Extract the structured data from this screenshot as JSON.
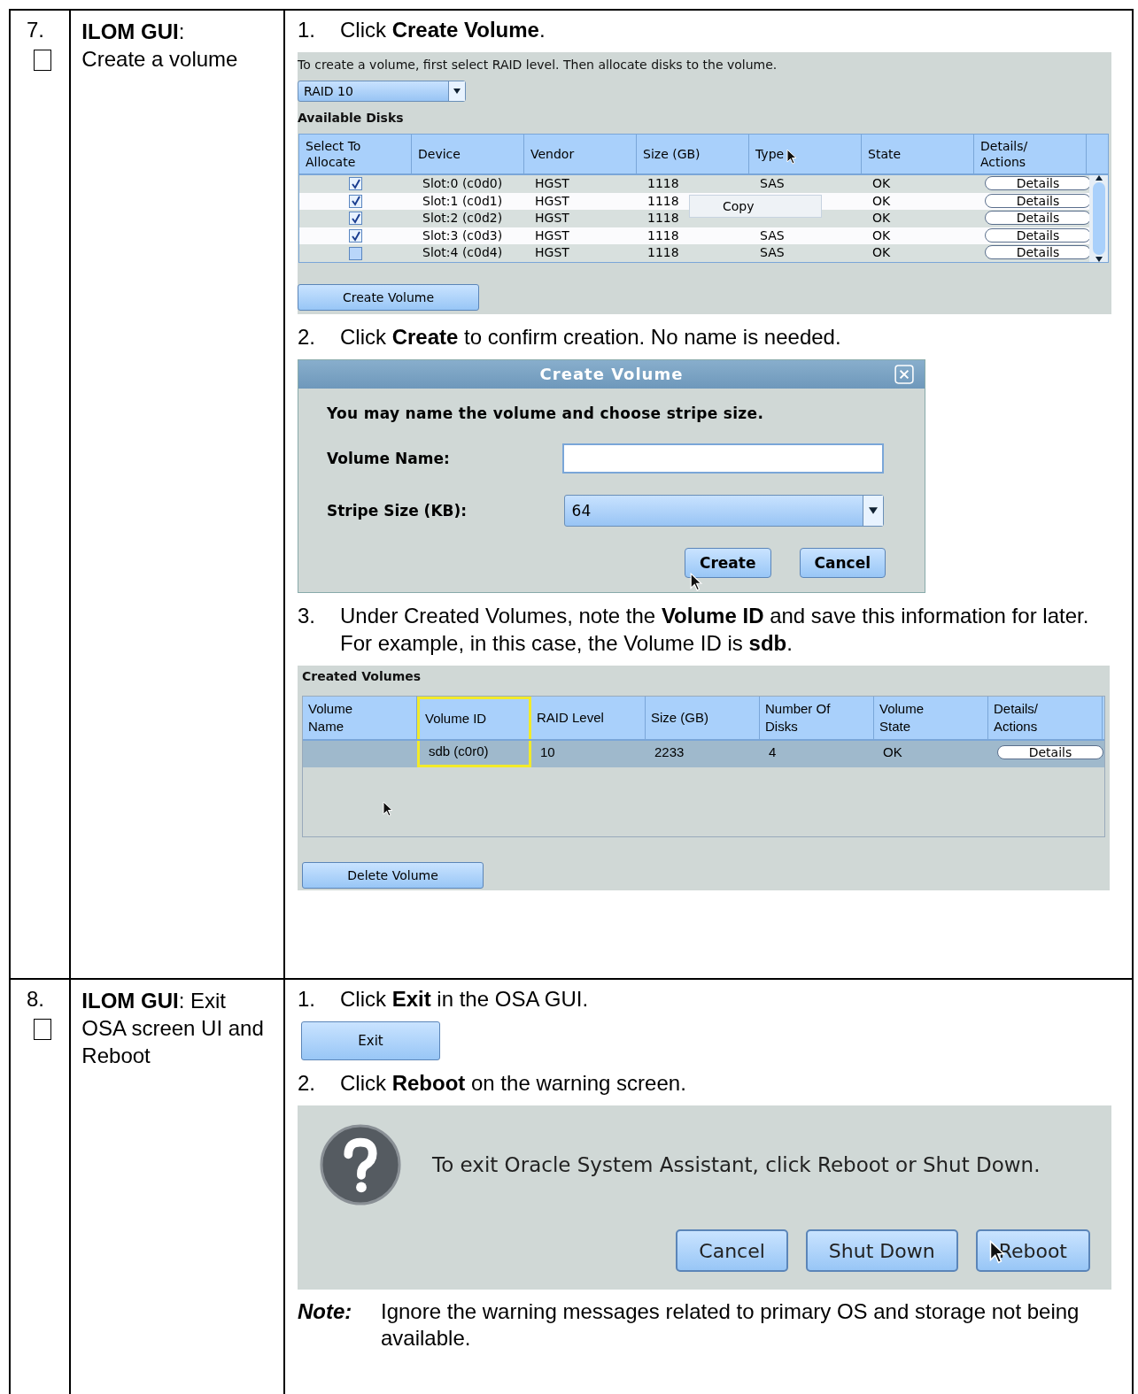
{
  "rows": [
    {
      "number": "7.",
      "checked": false,
      "task": "**ILOM GUI**:\nCreate a volume",
      "blocks": [
        {
          "kind": "step",
          "number": "1.",
          "text": "Click **Create Volume**."
        },
        {
          "kind": "create-panel",
          "intro": "To create a volume, first select RAID level. Then allocate disks to the volume.",
          "raid": "RAID 10",
          "heading": "Available Disks",
          "columns": [
            "Select To\nAllocate",
            "Device",
            "Vendor",
            "Size (GB)",
            "Type",
            "State",
            "Details/\nActions"
          ],
          "disks": [
            {
              "checked": true,
              "cells": [
                "Slot:0 (c0d0)",
                "HGST",
                "1118",
                "SAS",
                "OK"
              ],
              "action": "Details"
            },
            {
              "checked": true,
              "cells": [
                "Slot:1 (c0d1)",
                "HGST",
                "1118",
                null,
                "OK"
              ],
              "action": "Details"
            },
            {
              "checked": true,
              "cells": [
                "Slot:2 (c0d2)",
                "HGST",
                "1118",
                null,
                "OK"
              ],
              "action": "Details"
            },
            {
              "checked": true,
              "cells": [
                "Slot:3 (c0d3)",
                "HGST",
                "1118",
                "SAS",
                "OK"
              ],
              "action": "Details"
            },
            {
              "checked": false,
              "cells": [
                "Slot:4 (c0d4)",
                "HGST",
                "1118",
                "SAS",
                "OK"
              ],
              "action": "Details"
            }
          ],
          "menu": "Copy",
          "button": "Create Volume"
        },
        {
          "kind": "step",
          "number": "2.",
          "text": "Click **Create** to confirm creation.  No name is needed."
        },
        {
          "kind": "dialog",
          "title": "Create Volume",
          "message": "You may name the volume and choose stripe size.",
          "name_label": "Volume Name:",
          "stripe_label": "Stripe Size (KB):",
          "stripe": "64",
          "buttons": [
            "Create",
            "Cancel"
          ]
        },
        {
          "kind": "step",
          "number": "3.",
          "text": "Under Created Volumes, note the **Volume ID** and save this information for later.  For example, in this case, the Volume ID is **sdb**."
        },
        {
          "kind": "volumes-panel",
          "heading": "Created Volumes",
          "columns": [
            {
              "label": "Volume\nName",
              "highlighted": false
            },
            {
              "label": "Volume ID",
              "highlighted": true
            },
            {
              "label": "RAID Level",
              "highlighted": false
            },
            {
              "label": "Size (GB)",
              "highlighted": false
            },
            {
              "label": "Number Of\nDisks",
              "highlighted": false
            },
            {
              "label": "Volume\nState",
              "highlighted": false
            },
            {
              "label": "Details/\nActions",
              "highlighted": false
            }
          ],
          "volume": {
            "selected": true,
            "cells": [
              null,
              "sdb (c0r0)",
              "10",
              "2233",
              "4",
              "OK"
            ],
            "action": "Details"
          },
          "button": "Delete Volume"
        }
      ]
    },
    {
      "number": "8.",
      "checked": false,
      "task": "**ILOM GUI**:  Exit OSA screen UI and Reboot",
      "blocks": [
        {
          "kind": "step",
          "number": "1.",
          "text": "Click **Exit** in the OSA GUI."
        },
        {
          "kind": "exit-button",
          "label": "Exit"
        },
        {
          "kind": "step",
          "number": "2.",
          "text": "Click **Reboot** on the warning screen."
        },
        {
          "kind": "warning",
          "message": "To exit Oracle System Assistant, click Reboot or Shut Down.",
          "buttons": [
            "Cancel",
            "Shut Down",
            "Reboot"
          ]
        },
        {
          "kind": "note",
          "label": "Note:",
          "text": "Ignore the warning messages related to primary OS and storage not being available."
        }
      ]
    }
  ]
}
